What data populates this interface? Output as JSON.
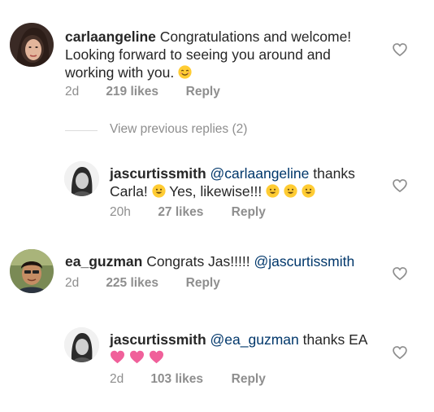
{
  "comments": [
    {
      "username": "carlaangeline",
      "text": "Congratulations and welcome! Looking forward to seeing you around and working with you.",
      "emoji": "smiling-face-with-smiling-eyes",
      "time": "2d",
      "likes": "219 likes",
      "reply": "Reply"
    },
    {
      "username": "jascurtissmith",
      "mention": "@carlaangeline",
      "text_1": "thanks Carla!",
      "text_2": "Yes, likewise!!!",
      "time": "20h",
      "likes": "27 likes",
      "reply": "Reply"
    },
    {
      "username": "ea_guzman",
      "text": "Congrats Jas!!!!!",
      "mention": "@jascurtissmith",
      "time": "2d",
      "likes": "225 likes",
      "reply": "Reply"
    },
    {
      "username": "jascurtissmith",
      "mention": "@ea_guzman",
      "text": "thanks EA",
      "time": "2d",
      "likes": "103 likes",
      "reply": "Reply"
    }
  ],
  "view_previous": "View previous replies (2)",
  "icons": {
    "like": "heart-outline-icon",
    "smile": "smiling-face-emoji",
    "heart": "pink-heart-emoji"
  },
  "colors": {
    "mention": "#00376b",
    "meta": "#8e8e8e",
    "text": "#262626",
    "heart_emoji": "#f0609a",
    "smile_emoji": "#ffcc33"
  }
}
